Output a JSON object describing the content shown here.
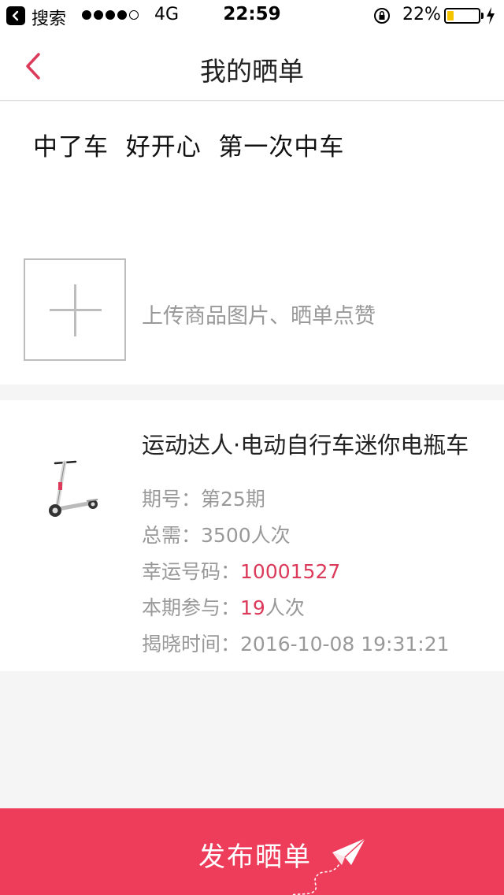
{
  "status_bar": {
    "back_app": "搜索",
    "network": "4G",
    "time": "22:59",
    "battery_percent": "22%",
    "battery_level": 0.22,
    "signal_bars_filled": 4,
    "signal_bars_total": 5
  },
  "nav": {
    "title": "我的晒单",
    "back_icon": "chevron-left-icon",
    "accent_color": "#dc3a5a"
  },
  "post": {
    "text": "中了车  好开心  第一次中车",
    "upload_hint": "上传商品图片、晒单点赞",
    "upload_icon": "plus-icon"
  },
  "product": {
    "title": "运动达人·电动自行车迷你电瓶车",
    "thumbnail": "electric-scooter-image",
    "period_label": "期号：",
    "period_value": "第25期",
    "total_label": "总需：",
    "total_value": "3500人次",
    "lucky_label": "幸运号码：",
    "lucky_value": "10001527",
    "join_label": "本期参与：",
    "join_value": "19",
    "join_suffix": "人次",
    "reveal_label": "揭晓时间：",
    "reveal_value": "2016-10-08 19:31:21"
  },
  "publish": {
    "label": "发布晒单",
    "icon": "paper-plane-icon",
    "color": "#ee3c5b"
  }
}
